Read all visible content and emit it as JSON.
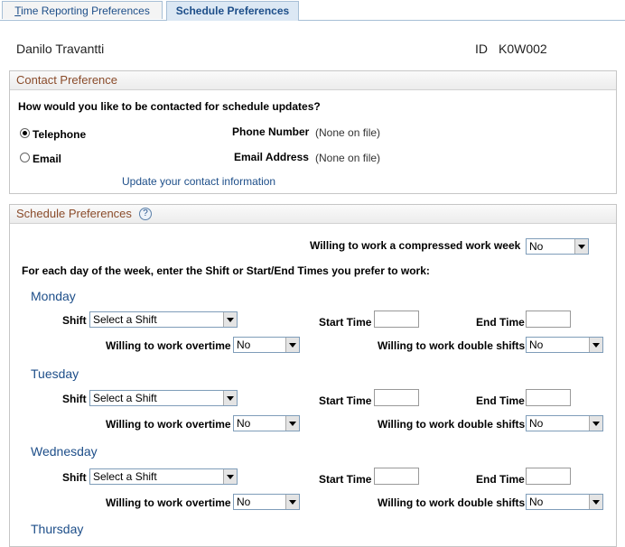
{
  "tabs": [
    {
      "accesskey": "T",
      "rest": "ime Reporting Preferences"
    },
    {
      "label": "Schedule Preferences"
    }
  ],
  "header": {
    "employee_name": "Danilo Travantti",
    "id_label": "ID",
    "id_value": "K0W002"
  },
  "contact": {
    "title": "Contact Preference",
    "question": "How would you like to be contacted for schedule updates?",
    "options": [
      "Telephone",
      "Email"
    ],
    "selected": "Telephone",
    "phone_label": "Phone Number",
    "phone_value": "(None on file)",
    "email_label": "Email Address",
    "email_value": "(None on file)",
    "update_link": "Update your contact information"
  },
  "schedule": {
    "title": "Schedule Preferences",
    "help_icon": "?",
    "compressed_label": "Willing to work a compressed work week",
    "compressed_value": "No",
    "instructions": "For each day of the week, enter the Shift or Start/End Times you prefer to work:",
    "labels": {
      "shift": "Shift",
      "start": "Start Time",
      "end": "End Time",
      "overtime": "Willing to work overtime",
      "double": "Willing to work double shifts"
    },
    "days": [
      {
        "name": "Monday",
        "shift": "Select a Shift",
        "overtime": "No",
        "double": "No"
      },
      {
        "name": "Tuesday",
        "shift": "Select a Shift",
        "overtime": "No",
        "double": "No"
      },
      {
        "name": "Wednesday",
        "shift": "Select a Shift",
        "overtime": "No",
        "double": "No"
      },
      {
        "name": "Thursday"
      }
    ]
  }
}
